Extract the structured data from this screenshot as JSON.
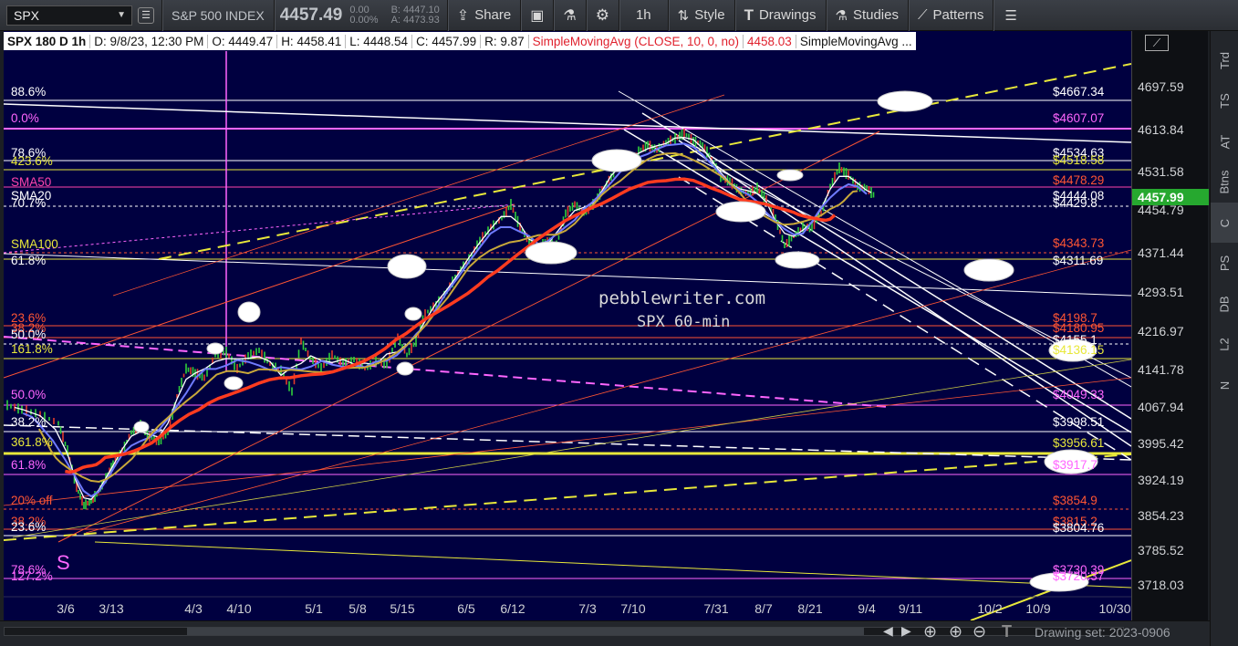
{
  "toolbar": {
    "symbol": "SPX",
    "index_name": "S&P 500 INDEX",
    "last": "4457.49",
    "change": "0.00",
    "change_pct": "0.00%",
    "bid": "B: 4447.10",
    "ask": "A: 4473.93",
    "share": "Share",
    "interval": "1h",
    "style": "Style",
    "drawings": "Drawings",
    "studies": "Studies",
    "patterns": "Patterns"
  },
  "legend": {
    "title": "SPX 180 D 1h",
    "date": "D: 9/8/23, 12:30 PM",
    "open": "O: 4449.47",
    "high": "H: 4458.41",
    "low": "L: 4448.54",
    "close": "C: 4457.99",
    "range": "R: 9.87",
    "sma10": "SimpleMovingAvg (CLOSE, 10, 0, no)",
    "sma10_value": "4458.03",
    "sma_more": "SimpleMovingAvg ..."
  },
  "watermark": {
    "line1": "pebblewriter.com",
    "line2": "SPX 60-min"
  },
  "price_axis": {
    "labels": [
      "4697.59",
      "4613.84",
      "4531.58",
      "4454.79",
      "4371.44",
      "4293.51",
      "4216.97",
      "4141.78",
      "4067.94",
      "3995.42",
      "3924.19",
      "3854.23",
      "3785.52",
      "3718.03"
    ],
    "current_price": "4457.99"
  },
  "time_axis": {
    "labels": [
      "3/6",
      "3/13",
      "4/3",
      "4/10",
      "5/1",
      "5/8",
      "5/15",
      "6/5",
      "6/12",
      "7/3",
      "7/10",
      "7/31",
      "8/7",
      "8/21",
      "9/4",
      "9/11",
      "10/2",
      "10/9",
      "10/30"
    ]
  },
  "left_labels": [
    {
      "text": "88.6%",
      "color": "#ffffff"
    },
    {
      "text": "0.0%",
      "color": "#ff66ff"
    },
    {
      "text": "78.6%",
      "color": "#ffffff"
    },
    {
      "text": "423.6%",
      "color": "#e8e83a"
    },
    {
      "text": "SMA50",
      "color": "#ff44aa"
    },
    {
      "text": "SMA20",
      "color": "#ffffff"
    },
    {
      "text": "70.7%",
      "color": "#ffffff"
    },
    {
      "text": "SMA100",
      "color": "#e8e83a"
    },
    {
      "text": "61.8%",
      "color": "#ffffff"
    },
    {
      "text": "23.6%",
      "color": "#ff5533"
    },
    {
      "text": "38.2%",
      "color": "#ff5533"
    },
    {
      "text": "50.0%",
      "color": "#ffffff"
    },
    {
      "text": "161.8%",
      "color": "#e8e83a"
    },
    {
      "text": "50.0%",
      "color": "#ff66ff"
    },
    {
      "text": "38.2%",
      "color": "#ffffff"
    },
    {
      "text": "361.8%",
      "color": "#e8e83a"
    },
    {
      "text": "61.8%",
      "color": "#ff66ff"
    },
    {
      "text": "20% off",
      "color": "#ff5533"
    },
    {
      "text": "38.2%",
      "color": "#ff5533"
    },
    {
      "text": "23.6%",
      "color": "#ffffff"
    },
    {
      "text": "78.6%",
      "color": "#ff66ff"
    },
    {
      "text": "127.2%",
      "color": "#ff66ff"
    },
    {
      "text": "S",
      "color": "#ff66ff"
    }
  ],
  "right_labels": [
    {
      "text": "$4667.34",
      "color": "#ffffff"
    },
    {
      "text": "$4607.07",
      "color": "#ff66ff"
    },
    {
      "text": "$4534.63",
      "color": "#ffffff"
    },
    {
      "text": "$4518.58",
      "color": "#e8e83a"
    },
    {
      "text": "$4478.29",
      "color": "#ff5533"
    },
    {
      "text": "$4444.08",
      "color": "#ffffff"
    },
    {
      "text": "$4429.8",
      "color": "#ffffff"
    },
    {
      "text": "$4343.73",
      "color": "#ff5533"
    },
    {
      "text": "$4311.69",
      "color": "#ffffff"
    },
    {
      "text": "$4198.7",
      "color": "#ff5533"
    },
    {
      "text": "$4180.95",
      "color": "#ff5533"
    },
    {
      "text": "$4155.1",
      "color": "#ffffff"
    },
    {
      "text": "$4136.15",
      "color": "#e8e83a"
    },
    {
      "text": "$4049.33",
      "color": "#ff66ff"
    },
    {
      "text": "$3998.51",
      "color": "#ffffff"
    },
    {
      "text": "$3956.61",
      "color": "#e8e83a"
    },
    {
      "text": "$3917.7",
      "color": "#ff66ff"
    },
    {
      "text": "$3854.9",
      "color": "#ff5533"
    },
    {
      "text": "$3815.2",
      "color": "#ff5533"
    },
    {
      "text": "$3804.76",
      "color": "#ffffff"
    },
    {
      "text": "$3730.39",
      "color": "#ff66ff"
    },
    {
      "text": "$3720.37",
      "color": "#ff66ff"
    }
  ],
  "side_tabs": [
    "Trd",
    "TS",
    "AT",
    "Btns",
    "C",
    "PS",
    "DB",
    "L2",
    "N"
  ],
  "bottombar": {
    "drawing_set": "Drawing set: 2023-0906"
  },
  "colors": {
    "chart_bg": "#000040",
    "sma10": "#ffffff",
    "sma20": "#6f7bff",
    "sma50": "#c8a83a",
    "sma100": "#ff3b1f",
    "fib_pink": "#ff66ff",
    "fib_yellow": "#e8e83a",
    "fib_red": "#ff5533"
  }
}
